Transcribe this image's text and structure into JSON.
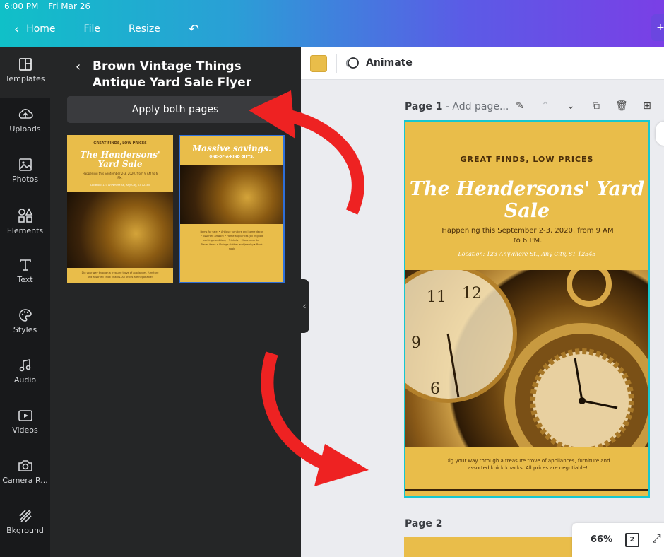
{
  "status": {
    "time": "6:00 PM",
    "date": "Fri Mar 26"
  },
  "topnav": {
    "home": "Home",
    "file": "File",
    "resize": "Resize"
  },
  "rail": [
    {
      "label": "Templates",
      "icon": "templates-icon"
    },
    {
      "label": "Uploads",
      "icon": "upload-icon"
    },
    {
      "label": "Photos",
      "icon": "photos-icon"
    },
    {
      "label": "Elements",
      "icon": "elements-icon"
    },
    {
      "label": "Text",
      "icon": "text-icon"
    },
    {
      "label": "Styles",
      "icon": "palette-icon"
    },
    {
      "label": "Audio",
      "icon": "music-icon"
    },
    {
      "label": "Videos",
      "icon": "video-icon"
    },
    {
      "label": "Camera R...",
      "icon": "camera-icon"
    },
    {
      "label": "Bkground",
      "icon": "background-icon"
    }
  ],
  "panel": {
    "title": "Brown Vintage Things Antique Yard Sale Flyer",
    "apply_label": "Apply both pages",
    "thumb1": {
      "kicker": "GREAT FINDS, LOW PRICES",
      "title": "The Hendersons' Yard Sale",
      "line": "Happening this September 2-3, 2020, from 9 AM to 6 PM.",
      "location": "Location: 123 Anywhere St., Any City, ST 12345",
      "body": "Dig your way through a treasure trove of appliances, furniture and assorted knick knacks. All prices are negotiable!"
    },
    "thumb2": {
      "title": "Massive savings.",
      "subtitle": "ONE-OF-A-KIND GIFTS.",
      "list": "Items for sale: • Antique furniture and home decor • Assorted artwork • Home appliances (all in good working condition) • Trinkets • Music records • Travel items • Vintage clothes and jewelry • Book nook"
    }
  },
  "toolbar": {
    "swatch_color": "#e9bd4a",
    "animate_label": "Animate"
  },
  "page1": {
    "label": "Page 1",
    "sub": " - Add page...",
    "kicker": "GREAT FINDS, LOW PRICES",
    "title": "The Hendersons' Yard Sale",
    "happening": "Happening this September 2-3, 2020, from 9 AM to 6 PM.",
    "location": "Location: 123 Anywhere St., Any City, ST 12345",
    "body": "Dig your way through a treasure trove of appliances, furniture and assorted knick knacks. All prices are negotiable!"
  },
  "page2": {
    "label": "Page 2"
  },
  "zoom": {
    "value": "66%",
    "pages": "2"
  }
}
